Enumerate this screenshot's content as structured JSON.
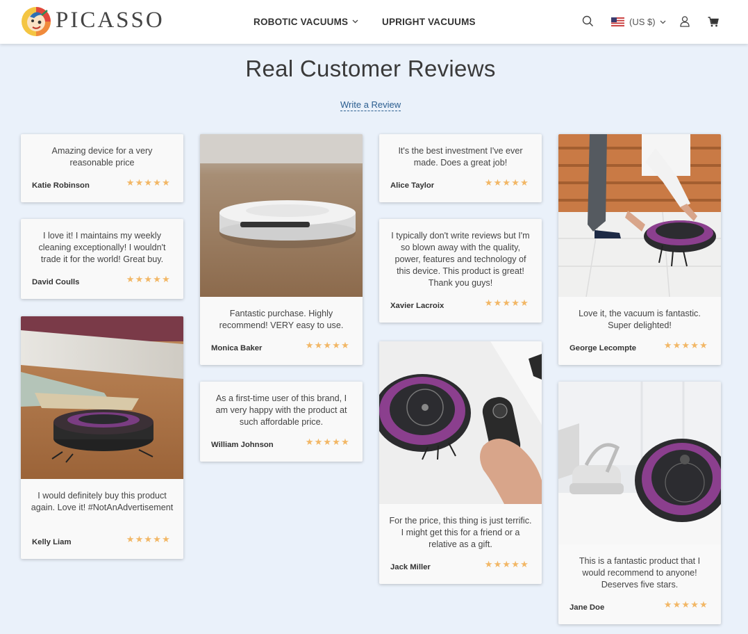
{
  "brand": {
    "name": "PICASSO"
  },
  "nav": {
    "robotic": "ROBOTIC VACUUMS",
    "upright": "UPRIGHT VACUUMS"
  },
  "header": {
    "currency": "(US $)"
  },
  "page": {
    "title": "Real Customer Reviews",
    "write_review": "Write a Review"
  },
  "colors": {
    "background": "#eaf1fa",
    "star": "#f2b766",
    "link": "#2a5d8f",
    "card": "#f9f9f9"
  },
  "rating": {
    "stars": "★★★★★",
    "value": 5,
    "max": 5
  },
  "reviews": [
    {
      "name": "Katie Robinson",
      "text": "Amazing device for a very reasonable price"
    },
    {
      "name": "David Coulls",
      "text": "I love it! I maintains my weekly cleaning exceptionally! I wouldn't trade it for the world! Great buy."
    },
    {
      "name": "Kelly Liam",
      "text": "I would definitely buy this product again. Love it! #NotAnAdvertisement"
    },
    {
      "name": "Monica Baker",
      "text": "Fantastic purchase. Highly recommend! VERY easy to use."
    },
    {
      "name": "William Johnson",
      "text": "As a first-time user of this brand, I am very happy with the product at such affordable price."
    },
    {
      "name": "Alice Taylor",
      "text": "It's the best investment I've ever made. Does a great job!"
    },
    {
      "name": "Xavier Lacroix",
      "text": "I typically don't write reviews but I'm so blown away with the quality, power, features and technology of this device. This product is great! Thank you guys!"
    },
    {
      "name": "Jack Miller",
      "text": "For the price, this thing is just terrific. I might get this for a friend or a relative as a gift."
    },
    {
      "name": "George Lecompte",
      "text": "Love it, the vacuum is fantastic. Super delighted!"
    },
    {
      "name": "Jane Doe",
      "text": "This is a fantastic product that I would recommend to anyone! Deserves five stars."
    }
  ]
}
